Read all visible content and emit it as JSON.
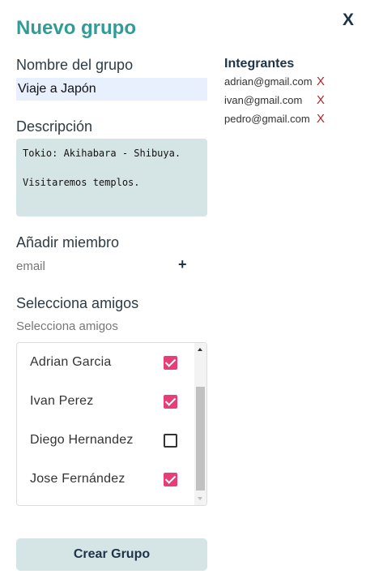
{
  "header": {
    "title": "Nuevo grupo",
    "close_label": "X"
  },
  "form": {
    "group_name_label": "Nombre del grupo",
    "group_name_value": "Viaje a Japón",
    "description_label": "Descripción",
    "description_value": "Tokio: Akihabara - Shibuya.\n\nVisitaremos templos.",
    "add_member_label": "Añadir miembro",
    "email_placeholder": "email",
    "add_icon_glyph": "+",
    "select_friends_label": "Selecciona amigos",
    "select_friends_placeholder": "Selecciona amigos",
    "friends": [
      {
        "name": "Adrian Garcia",
        "checked": true
      },
      {
        "name": "Ivan Perez",
        "checked": true
      },
      {
        "name": "Diego Hernandez",
        "checked": false
      },
      {
        "name": "Jose Fernández",
        "checked": true
      }
    ],
    "submit_label": "Crear Grupo"
  },
  "members": {
    "title": "Integrantes",
    "remove_label": "X",
    "items": [
      {
        "email": "adrian@gmail.com"
      },
      {
        "email": "ivan@gmail.com"
      },
      {
        "email": "pedro@gmail.com"
      }
    ]
  },
  "colors": {
    "title": "#2f9d96",
    "checkbox_checked": "#e83e78",
    "remove": "#b0252b",
    "button_bg": "#d5e5e5"
  }
}
